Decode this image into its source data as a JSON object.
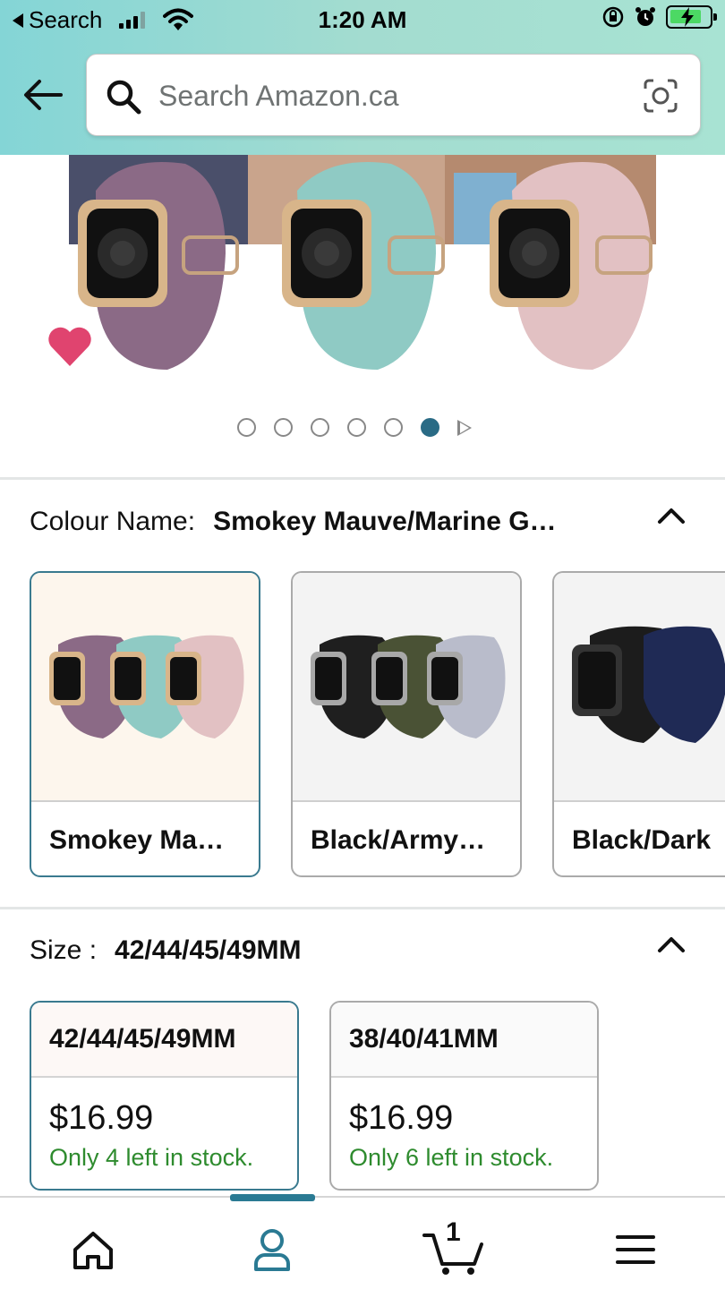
{
  "status_bar": {
    "back_label": "Search",
    "time": "1:20 AM"
  },
  "header": {
    "search_placeholder": "Search Amazon.ca"
  },
  "gallery": {
    "dot_count": 6,
    "active_dot": 6
  },
  "colour_section": {
    "label": "Colour Name:",
    "value": "Smokey Mauve/Marine G…",
    "options": [
      {
        "name": "Smokey Ma…",
        "selected": true
      },
      {
        "name": "Black/Army…",
        "selected": false
      },
      {
        "name": "Black/Dark",
        "selected": false
      }
    ]
  },
  "size_section": {
    "label": "Size :",
    "value": "42/44/45/49MM",
    "options": [
      {
        "size": "42/44/45/49MM",
        "price": "$16.99",
        "stock": "Only 4 left in stock.",
        "selected": true
      },
      {
        "size": "38/40/41MM",
        "price": "$16.99",
        "stock": "Only 6 left in stock.",
        "selected": false
      }
    ]
  },
  "bottom_nav": {
    "cart_count": "1",
    "accent_color": "#2a7a93"
  },
  "colors": {
    "selected_border": "#3a7a8f",
    "stock_green": "#2e8b2e",
    "heart_pink": "#e0446f"
  }
}
